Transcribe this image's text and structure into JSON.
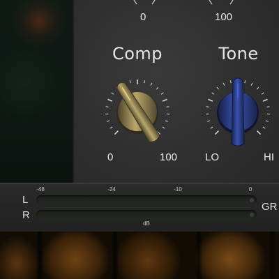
{
  "top_scales": {
    "left_zero": "0",
    "right_hundred": "100"
  },
  "knobs": [
    {
      "title": "Comp",
      "min_label": "0",
      "max_label": "100",
      "value_fraction": 0.38,
      "color": "#8a7c4f"
    },
    {
      "title": "Tone",
      "min_label": "LO",
      "max_label": "HI",
      "value_fraction": 0.5,
      "color": "#2b3c84"
    }
  ],
  "meter": {
    "ticks": [
      "-48",
      "-24",
      "-10",
      "0"
    ],
    "channels": [
      "L",
      "R"
    ],
    "gr_label": "GR",
    "unit_label": "dB"
  },
  "colors": {
    "panel": "#2f2f2f",
    "comp_knob": "#8a7c4f",
    "tone_knob": "#2b3c84"
  }
}
